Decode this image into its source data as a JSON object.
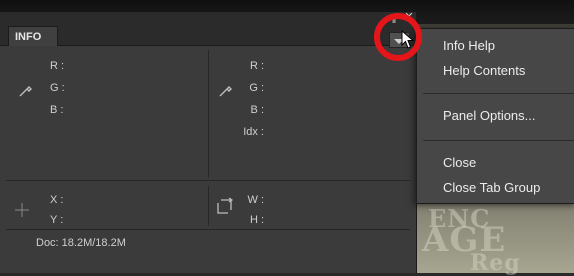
{
  "panel": {
    "tab_label": "INFO",
    "window_controls": {
      "collapse": "‖",
      "close": "✕"
    },
    "color_section": {
      "left_labels": [
        "R :",
        "G :",
        "B :"
      ],
      "right_labels": [
        "R :",
        "G :",
        "B :",
        "Idx :"
      ]
    },
    "position_section": {
      "x_label": "X :",
      "y_label": "Y :",
      "w_label": "W :",
      "h_label": "H :"
    },
    "doc_status": "Doc: 18.2M/18.2M"
  },
  "flyout_menu": {
    "group1": [
      "Info Help",
      "Help Contents"
    ],
    "group2": [
      "Panel Options..."
    ],
    "group3": [
      "Close",
      "Close Tab Group"
    ]
  },
  "background": {
    "photo_words": [
      "ENC",
      "AGE",
      "Reg"
    ]
  },
  "colors": {
    "highlight_circle": "#e4161a",
    "panel_bg": "#3b3b3b",
    "menu_bg": "#474747"
  }
}
